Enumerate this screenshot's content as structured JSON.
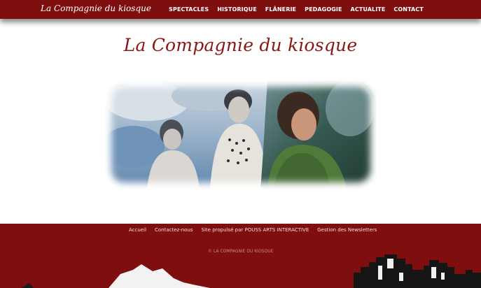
{
  "header": {
    "brand": "La Compagnie du kiosque",
    "nav": [
      "SPECTACLES",
      "HISTORIQUE",
      "FLÂNERIE",
      "PEDAGOGIE",
      "ACTUALITE",
      "CONTACT"
    ]
  },
  "main": {
    "title": "La Compagnie du kiosque"
  },
  "footer": {
    "links": [
      "Accueil",
      "Contactez-nous",
      "Site propulsé par POUSS ARTS INTERACTIVE",
      "Gestion des Newsletters"
    ],
    "copyright": "© LA COMPAGNIE DU KIOSQUE"
  },
  "colors": {
    "brand": "#7f0e0f",
    "title": "#8a1717"
  }
}
